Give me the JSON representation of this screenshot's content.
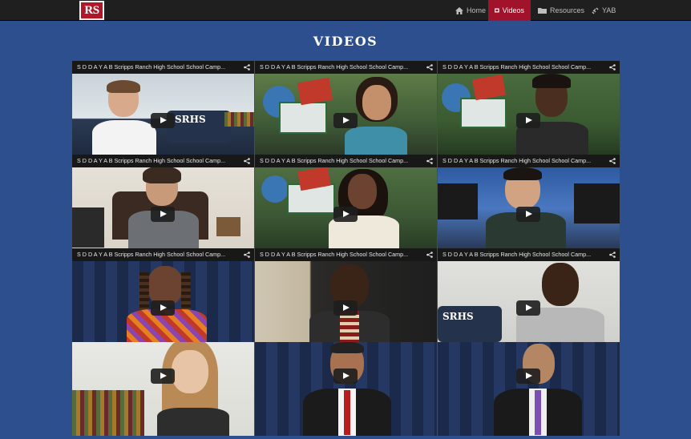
{
  "brand": {
    "logo_text": "RS"
  },
  "nav": {
    "items": [
      {
        "label": "Home",
        "icon": "home-icon"
      },
      {
        "label": "Videos",
        "icon": "video-icon",
        "active": true
      },
      {
        "label": "Resources",
        "icon": "folder-icon"
      },
      {
        "label": "YAB",
        "icon": "link-icon"
      }
    ]
  },
  "page": {
    "title": "VIDEOS"
  },
  "videos": [
    {
      "title": "S D D A Y A B Scripps Ranch High School School Camp...",
      "scene": "student-boy-white-shirt"
    },
    {
      "title": "S D D A Y A B Scripps Ranch High School School Camp...",
      "scene": "student-girl-classroom"
    },
    {
      "title": "S D D A Y A B Scripps Ranch High School School Camp...",
      "scene": "student-girl-classroom-2"
    },
    {
      "title": "S D D A Y A B Scripps Ranch High School School Camp...",
      "scene": "woman-office"
    },
    {
      "title": "S D D A Y A B Scripps Ranch High School School Camp...",
      "scene": "student-girl-globe"
    },
    {
      "title": "S D D A Y A B Scripps Ranch High School School Camp...",
      "scene": "student-boy-computer-lab"
    },
    {
      "title": "S D D A Y A B Scripps Ranch High School School Camp...",
      "scene": "man-dreadlocks"
    },
    {
      "title": "S D D A Y A B Scripps Ranch High School School Camp...",
      "scene": "student-boy-dark"
    },
    {
      "title": "S D D A Y A B Scripps Ranch High School School Camp...",
      "scene": "student-boy-hoodie"
    },
    {
      "title": "",
      "scene": "student-girl-blonde"
    },
    {
      "title": "",
      "scene": "man-suit-red-tie"
    },
    {
      "title": "",
      "scene": "man-suit-purple-tie"
    }
  ],
  "colors": {
    "background": "#2d4f8d",
    "navbar": "#1f1f1f",
    "accent": "#a0132a"
  }
}
